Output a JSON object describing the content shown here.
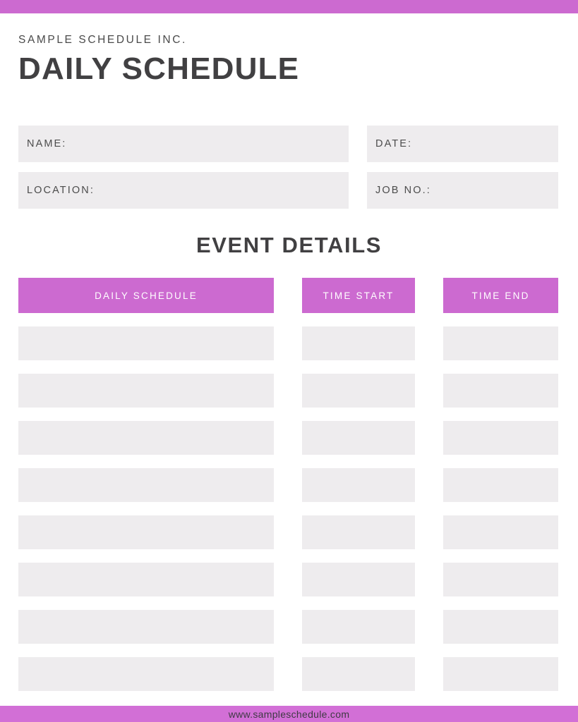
{
  "document": {
    "company_name": "SAMPLE SCHEDULE INC.",
    "title": "DAILY SCHEDULE"
  },
  "info_fields": {
    "rows": [
      [
        {
          "label": "NAME:",
          "value": "",
          "placeholder": ""
        },
        {
          "label": "DATE:",
          "value": "",
          "placeholder": ""
        }
      ],
      [
        {
          "label": "LOCATION:",
          "value": "",
          "placeholder": ""
        },
        {
          "label": "JOB NO.:",
          "value": "",
          "placeholder": ""
        }
      ]
    ]
  },
  "event_details": {
    "heading": "EVENT DETAILS",
    "columns": [
      {
        "label": "DAILY SCHEDULE"
      },
      {
        "label": "TIME START"
      },
      {
        "label": "TIME END"
      }
    ],
    "row_count": 8,
    "rows": [
      {
        "schedule": "",
        "time_start": "",
        "time_end": ""
      },
      {
        "schedule": "",
        "time_start": "",
        "time_end": ""
      },
      {
        "schedule": "",
        "time_start": "",
        "time_end": ""
      },
      {
        "schedule": "",
        "time_start": "",
        "time_end": ""
      },
      {
        "schedule": "",
        "time_start": "",
        "time_end": ""
      },
      {
        "schedule": "",
        "time_start": "",
        "time_end": ""
      },
      {
        "schedule": "",
        "time_start": "",
        "time_end": ""
      },
      {
        "schedule": "",
        "time_start": "",
        "time_end": ""
      }
    ]
  },
  "footer": {
    "website": "www.sampleschedule.com"
  },
  "colors": {
    "accent": "#cc6ad0",
    "footer_bar": "#d26fd6",
    "field_fill": "#eeecee",
    "text_dark": "#414042",
    "text_muted": "#4c4c4c",
    "header_text": "#ffffff"
  }
}
